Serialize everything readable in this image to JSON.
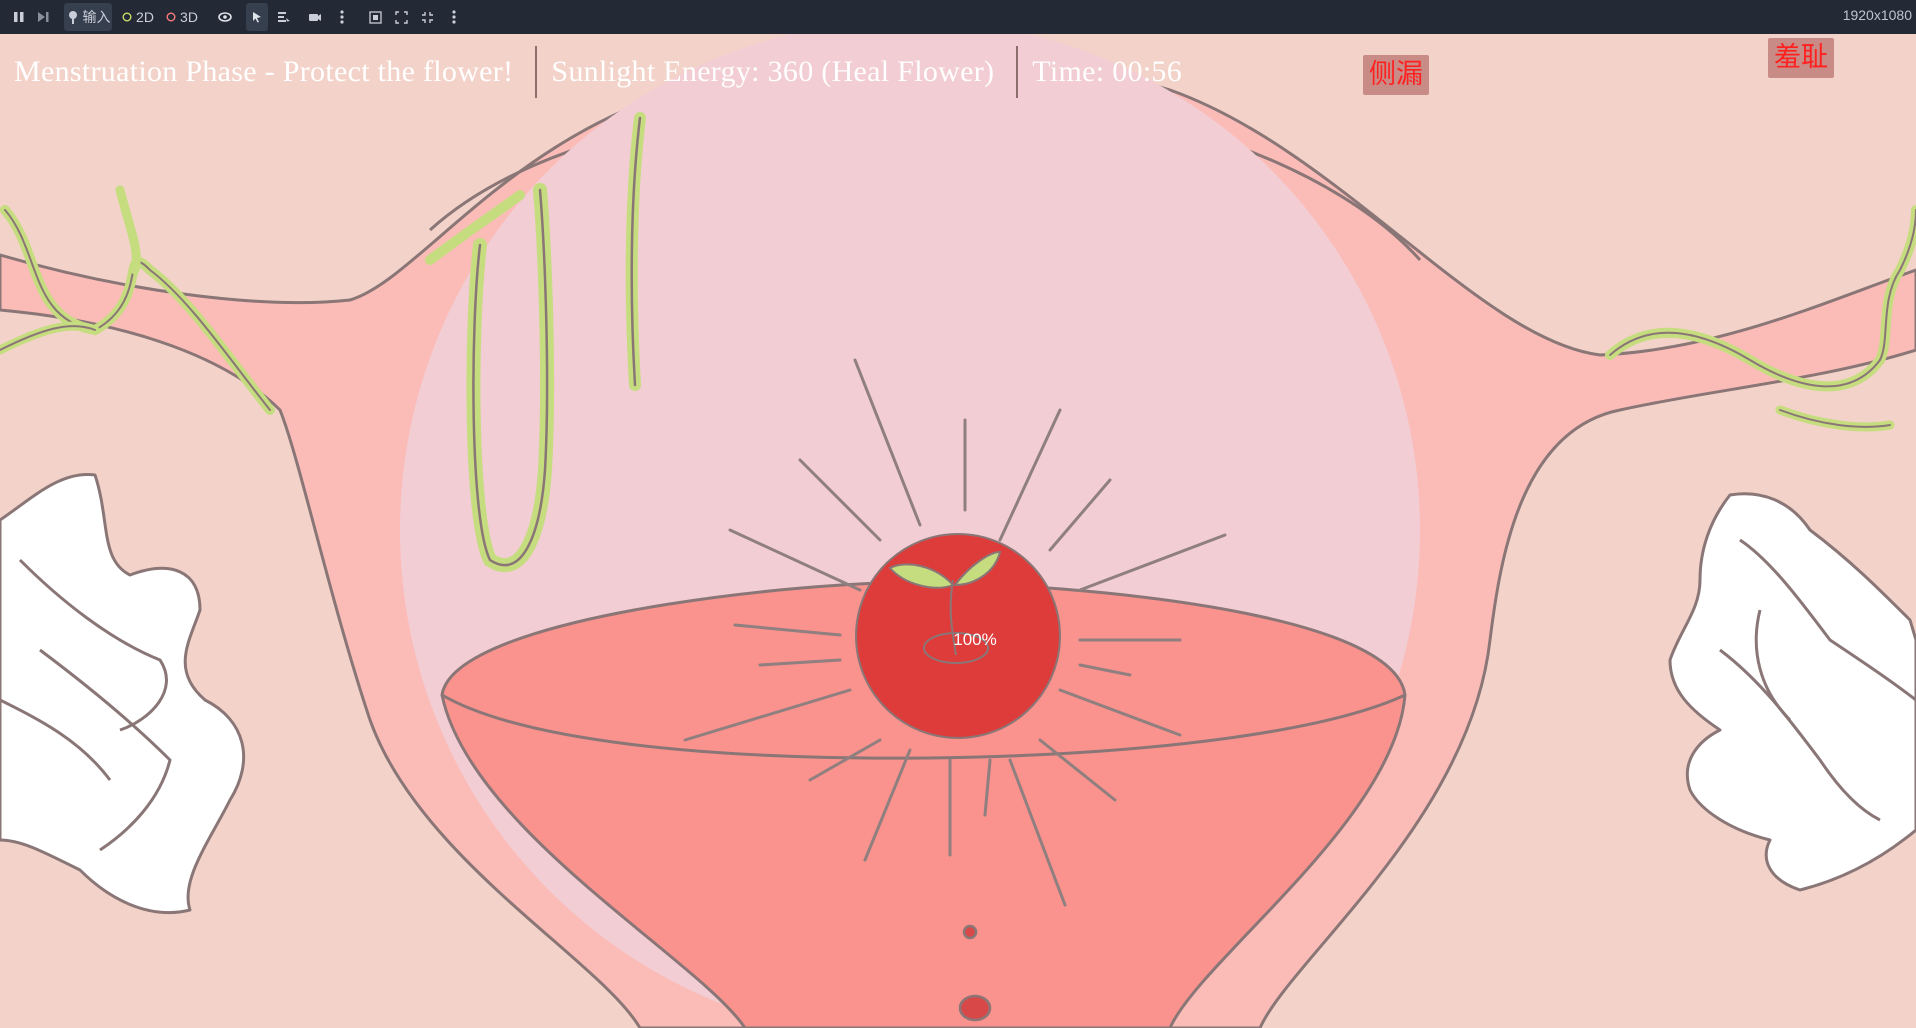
{
  "editor": {
    "input_label": "输入",
    "mode_2d": "2D",
    "mode_3d": "3D",
    "resolution": "1920x1080"
  },
  "hud": {
    "phase_text": "Menstruation Phase - Protect the flower!",
    "energy_text": "Sunlight Energy: 360 (Heal Flower)",
    "time_text": "Time: 00:56"
  },
  "buttons": {
    "side_leak": "侧漏",
    "shame": "羞耻"
  },
  "flower": {
    "health_text": "100%",
    "health": 1.0
  },
  "colors": {
    "background": "#f3d3c9",
    "uterus": "#fbbcb8",
    "womb_circle": "#f2cdd3",
    "blood_pool": "#fa928e",
    "seed_orb": "#de3b3b",
    "vine": "#c5dc7f",
    "button_bg": "#c98b86",
    "button_text": "#ff2020"
  }
}
